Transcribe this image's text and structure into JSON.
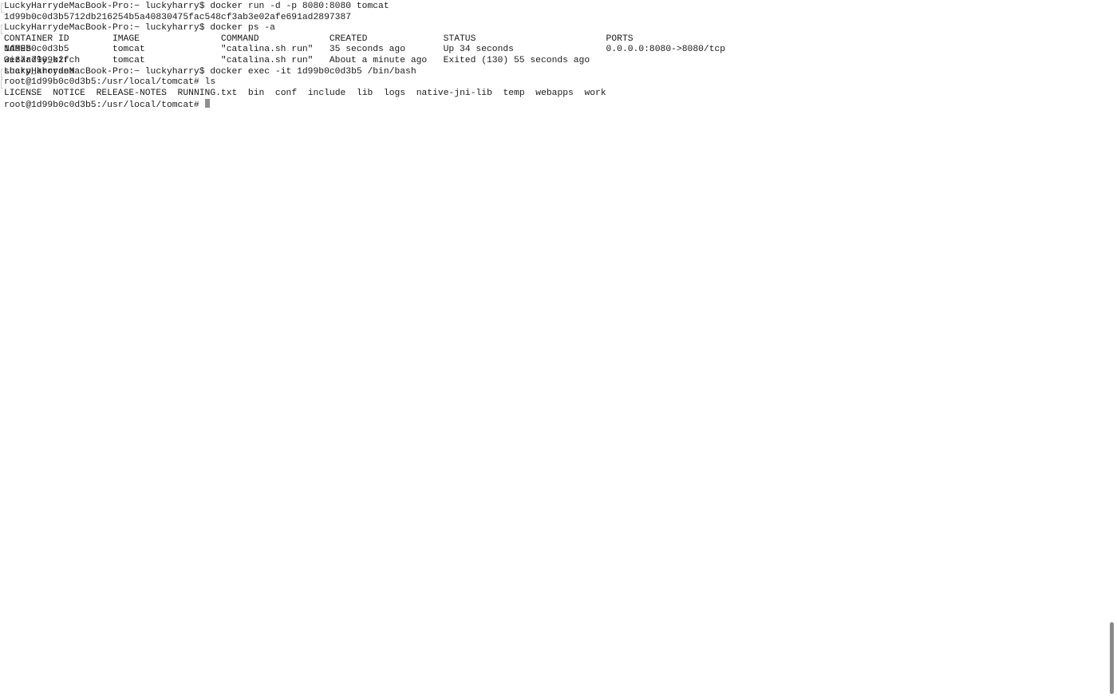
{
  "terminal": {
    "lines": {
      "cmd1": "LuckyHarrydeMacBook-Pro:~ luckyharry$ docker run -d -p 8080:8080 tomcat",
      "out1": "1d99b0c0d3b5712db216254b5a40830475fac548cf3ab3e02afe691ad2897387",
      "cmd2": "LuckyHarrydeMacBook-Pro:~ luckyharry$ docker ps -a",
      "cmd3": "LuckyHarrydeMacBook-Pro:~ luckyharry$ docker exec -it 1d99b0c0d3b5 /bin/bash",
      "cmd4": "root@1d99b0c0d3b5:/usr/local/tomcat# ls",
      "prompt": "root@1d99b0c0d3b5:/usr/local/tomcat#"
    },
    "ps_table": {
      "headers": [
        "CONTAINER ID",
        "IMAGE",
        "COMMAND",
        "CREATED",
        "STATUS",
        "PORTS",
        "NAMES"
      ],
      "rows": [
        [
          "1d99b0c0d3b5",
          "tomcat",
          "\"catalina.sh run\"",
          "35 seconds ago",
          "Up 34 seconds",
          "0.0.0.0:8080->8080/tcp",
          "wizardly_kirch"
        ],
        [
          "3e67a7909b2f",
          "tomcat",
          "\"catalina.sh run\"",
          "About a minute ago",
          "Exited (130) 55 seconds ago",
          "",
          "sharp_khorana"
        ]
      ]
    },
    "ls_output": [
      "LICENSE",
      "NOTICE",
      "RELEASE-NOTES",
      "RUNNING.txt",
      "bin",
      "conf",
      "include",
      "lib",
      "logs",
      "native-jni-lib",
      "temp",
      "webapps",
      "work"
    ]
  }
}
